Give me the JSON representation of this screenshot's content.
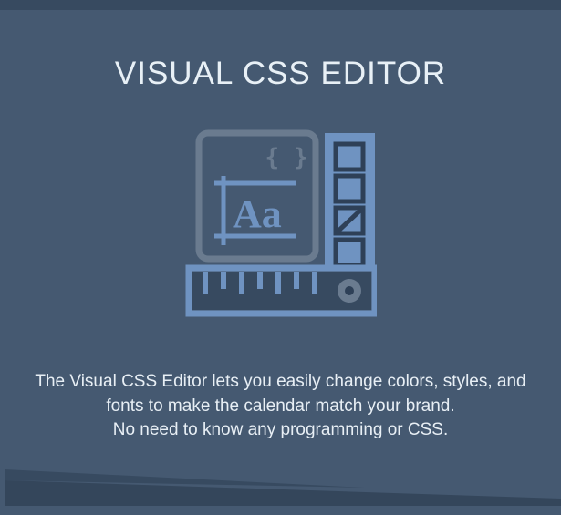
{
  "title": "VISUAL CSS EDITOR",
  "description_line1": "The Visual CSS Editor lets you easily change colors, styles, and fonts to make the calendar match your brand.",
  "description_line2": "No need to know any programming or CSS.",
  "colors": {
    "background": "#455971",
    "accent": "#6f93c1",
    "muted": "#6a7b8f",
    "text": "#e8f0f6"
  }
}
